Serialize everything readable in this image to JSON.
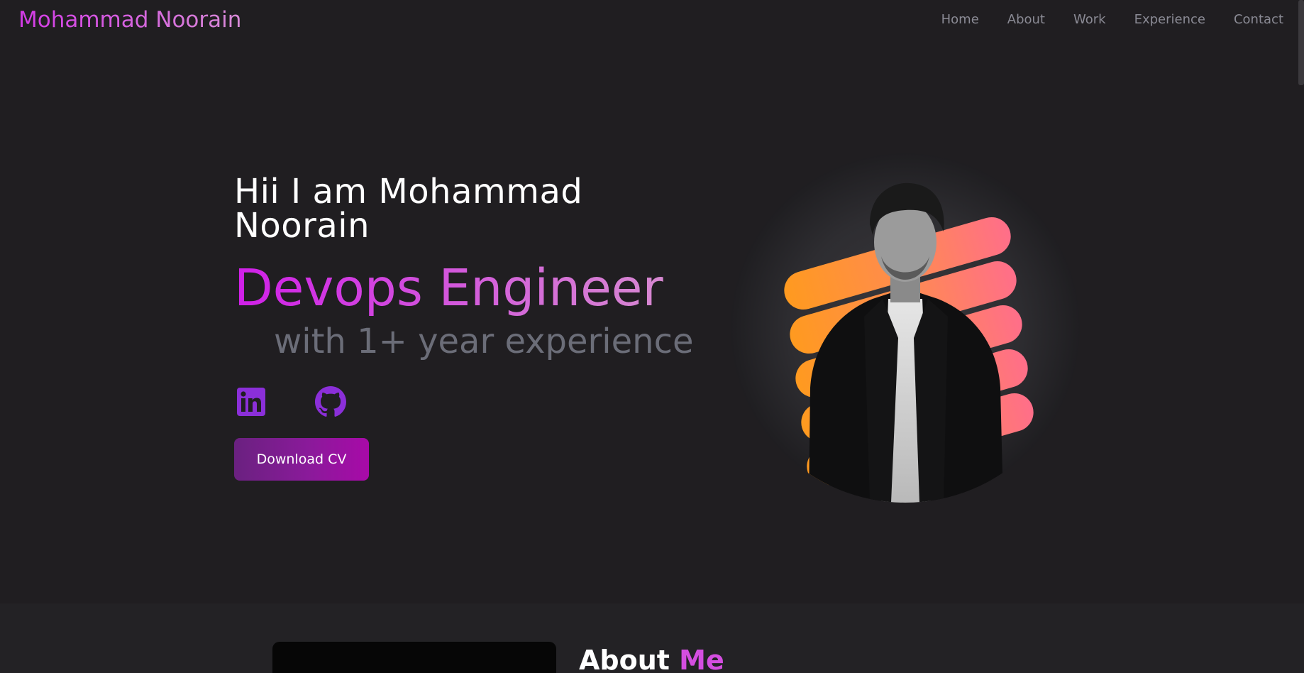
{
  "navbar": {
    "brand": "Mohammad Noorain",
    "links": [
      "Home",
      "About",
      "Work",
      "Experience",
      "Contact"
    ]
  },
  "hero": {
    "greeting": "Hii I am Mohammad Noorain",
    "role": "Devops Engineer",
    "experience": "with 1+ year experience",
    "socials": [
      {
        "icon": "linkedin-icon"
      },
      {
        "icon": "github-icon"
      }
    ],
    "download_label": "Download CV"
  },
  "about": {
    "heading_white": "About",
    "heading_accent": "Me"
  },
  "colors": {
    "background": "#201e21",
    "brand_start": "#d33ae6",
    "brand_end": "#d98bd8",
    "nav_link": "#8a8a94",
    "social_icon": "#8b2fd9",
    "button_start": "#6a2180",
    "button_end": "#a80aa8",
    "stripe_start": "#ff9a1f",
    "stripe_end": "#ff6e8a"
  }
}
